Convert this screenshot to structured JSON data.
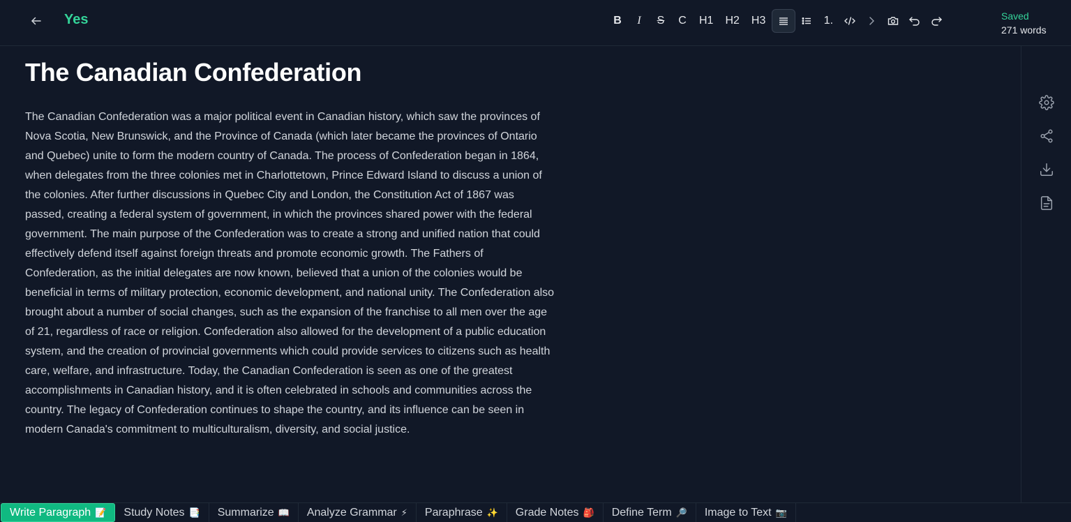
{
  "header": {
    "doc_name": "Yes",
    "status_saved": "Saved",
    "word_count": "271 words"
  },
  "toolbar": {
    "bold": "B",
    "italic": "I",
    "strike": "S",
    "code": "C",
    "h1": "H1",
    "h2": "H2",
    "h3": "H3",
    "ordered_list": "1."
  },
  "document": {
    "title": "The Canadian Confederation",
    "body": "The Canadian Confederation was a major political event in Canadian history, which saw the provinces of Nova Scotia, New Brunswick, and the Province of Canada (which later became the provinces of Ontario and Quebec) unite to form the modern country of Canada. The process of Confederation began in 1864, when delegates from the three colonies met in Charlottetown, Prince Edward Island to discuss a union of the colonies. After further discussions in Quebec City and London, the Constitution Act of 1867 was passed, creating a federal system of government, in which the provinces shared power with the federal government. The main purpose of the Confederation was to create a strong and unified nation that could effectively defend itself against foreign threats and promote economic growth. The Fathers of Confederation, as the initial delegates are now known, believed that a union of the colonies would be beneficial in terms of military protection, economic development, and national unity. The Confederation also brought about a number of social changes, such as the expansion of the franchise to all men over the age of 21, regardless of race or religion. Confederation also allowed for the development of a public education system, and the creation of provincial governments which could provide services to citizens such as health care, welfare, and infrastructure. Today, the Canadian Confederation is seen as one of the greatest accomplishments in Canadian history, and it is often celebrated in schools and communities across the country. The legacy of Confederation continues to shape the country, and its influence can be seen in modern Canada's commitment to multiculturalism, diversity, and social justice."
  },
  "tabs": [
    {
      "label": "Write Paragraph",
      "emoji": "📝"
    },
    {
      "label": "Study Notes",
      "emoji": "📑"
    },
    {
      "label": "Summarize",
      "emoji": "📖"
    },
    {
      "label": "Analyze Grammar",
      "emoji": "⚡"
    },
    {
      "label": "Paraphrase",
      "emoji": "✨"
    },
    {
      "label": "Grade Notes",
      "emoji": "🎒"
    },
    {
      "label": "Define Term",
      "emoji": "🔎"
    },
    {
      "label": "Image to Text",
      "emoji": "📷"
    }
  ],
  "colors": {
    "background": "#111827",
    "accent": "#34d399",
    "active_tab": "#10b981"
  }
}
